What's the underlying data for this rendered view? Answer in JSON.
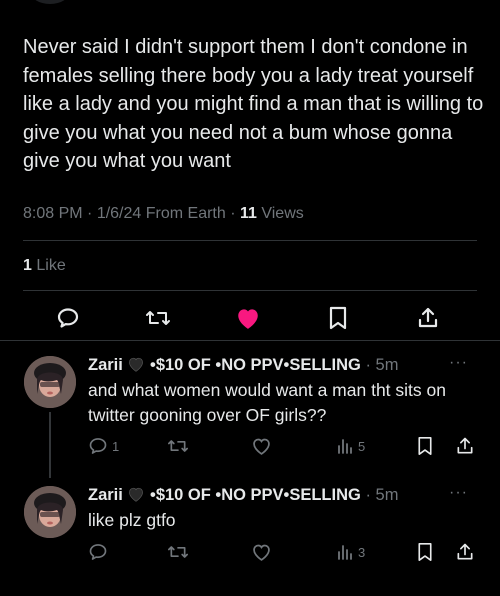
{
  "tweet": {
    "text": "Never said I didn't support them I don't condone in females selling there body you a lady treat yourself like a lady and you might find a man that is willing to give you what you need not a bum whose gonna give you what you want",
    "time": "8:08 PM",
    "date": "1/6/24",
    "source": "From Earth",
    "views_count": "11",
    "views_label": "Views",
    "likes_count": "1",
    "likes_label": "Like"
  },
  "actions": {
    "icons": [
      "reply-icon",
      "retweet-icon",
      "like-icon-filled",
      "bookmark-icon",
      "share-icon"
    ],
    "like_color": "#f91880"
  },
  "replies": [
    {
      "name": "Zarii",
      "handle_suffix": "•$10 OF •NO PPV•SELLING",
      "time": "5m",
      "more": "···",
      "text": "and what women would want a man tht sits on twitter gooning over OF girls??",
      "reply_count": "1",
      "retweet_count": "",
      "like_count": "",
      "views_count": "5"
    },
    {
      "name": "Zarii",
      "handle_suffix": "•$10 OF •NO PPV•SELLING",
      "time": "5m",
      "more": "···",
      "text": "like plz gtfo",
      "reply_count": "",
      "retweet_count": "",
      "like_count": "",
      "views_count": "3"
    }
  ],
  "colors": {
    "background": "#000000",
    "text": "#e7e9ea",
    "muted": "#71767b",
    "divider": "#2f3336"
  }
}
